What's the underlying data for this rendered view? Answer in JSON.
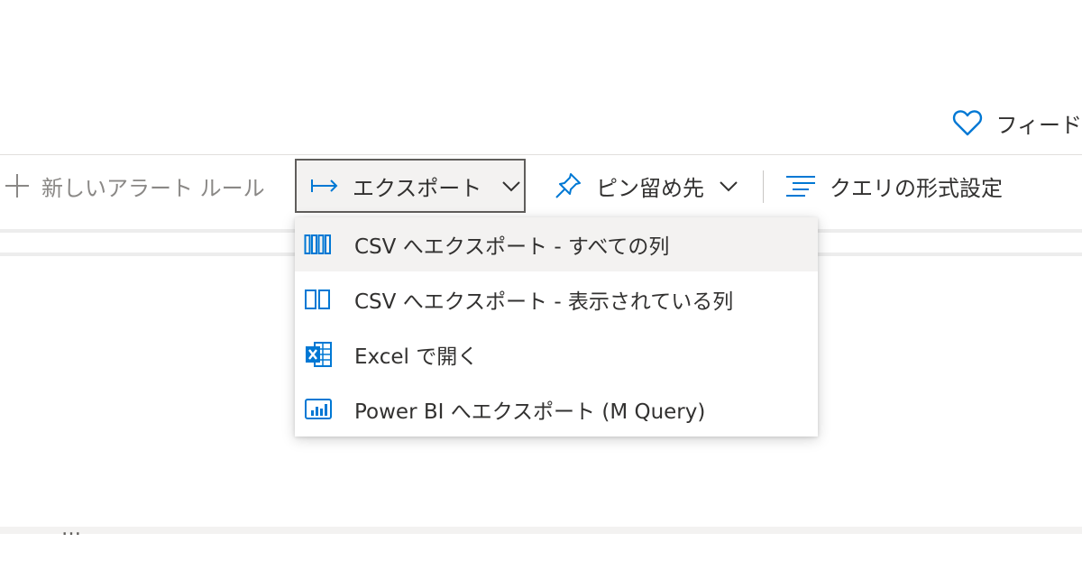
{
  "feedback": {
    "label": "フィード"
  },
  "toolbar": {
    "new_alert_rule": "新しいアラート ルール",
    "export": "エクスポート",
    "pin_to": "ピン留め先",
    "format_query": "クエリの形式設定"
  },
  "export_menu": {
    "items": [
      {
        "label": "CSV へエクスポート - すべての列",
        "icon": "csv-all-columns-icon"
      },
      {
        "label": "CSV へエクスポート - 表示されている列",
        "icon": "csv-visible-columns-icon"
      },
      {
        "label": "Excel で開く",
        "icon": "excel-icon"
      },
      {
        "label": "Power BI へエクスポート (M Query)",
        "icon": "power-bi-icon"
      }
    ]
  },
  "more": {
    "label": "…"
  },
  "colors": {
    "accent": "#0078d4",
    "text": "#323130",
    "disabled_text": "#8a8886",
    "hover_bg": "#f3f2f1",
    "excel_green": "#0078d4"
  }
}
